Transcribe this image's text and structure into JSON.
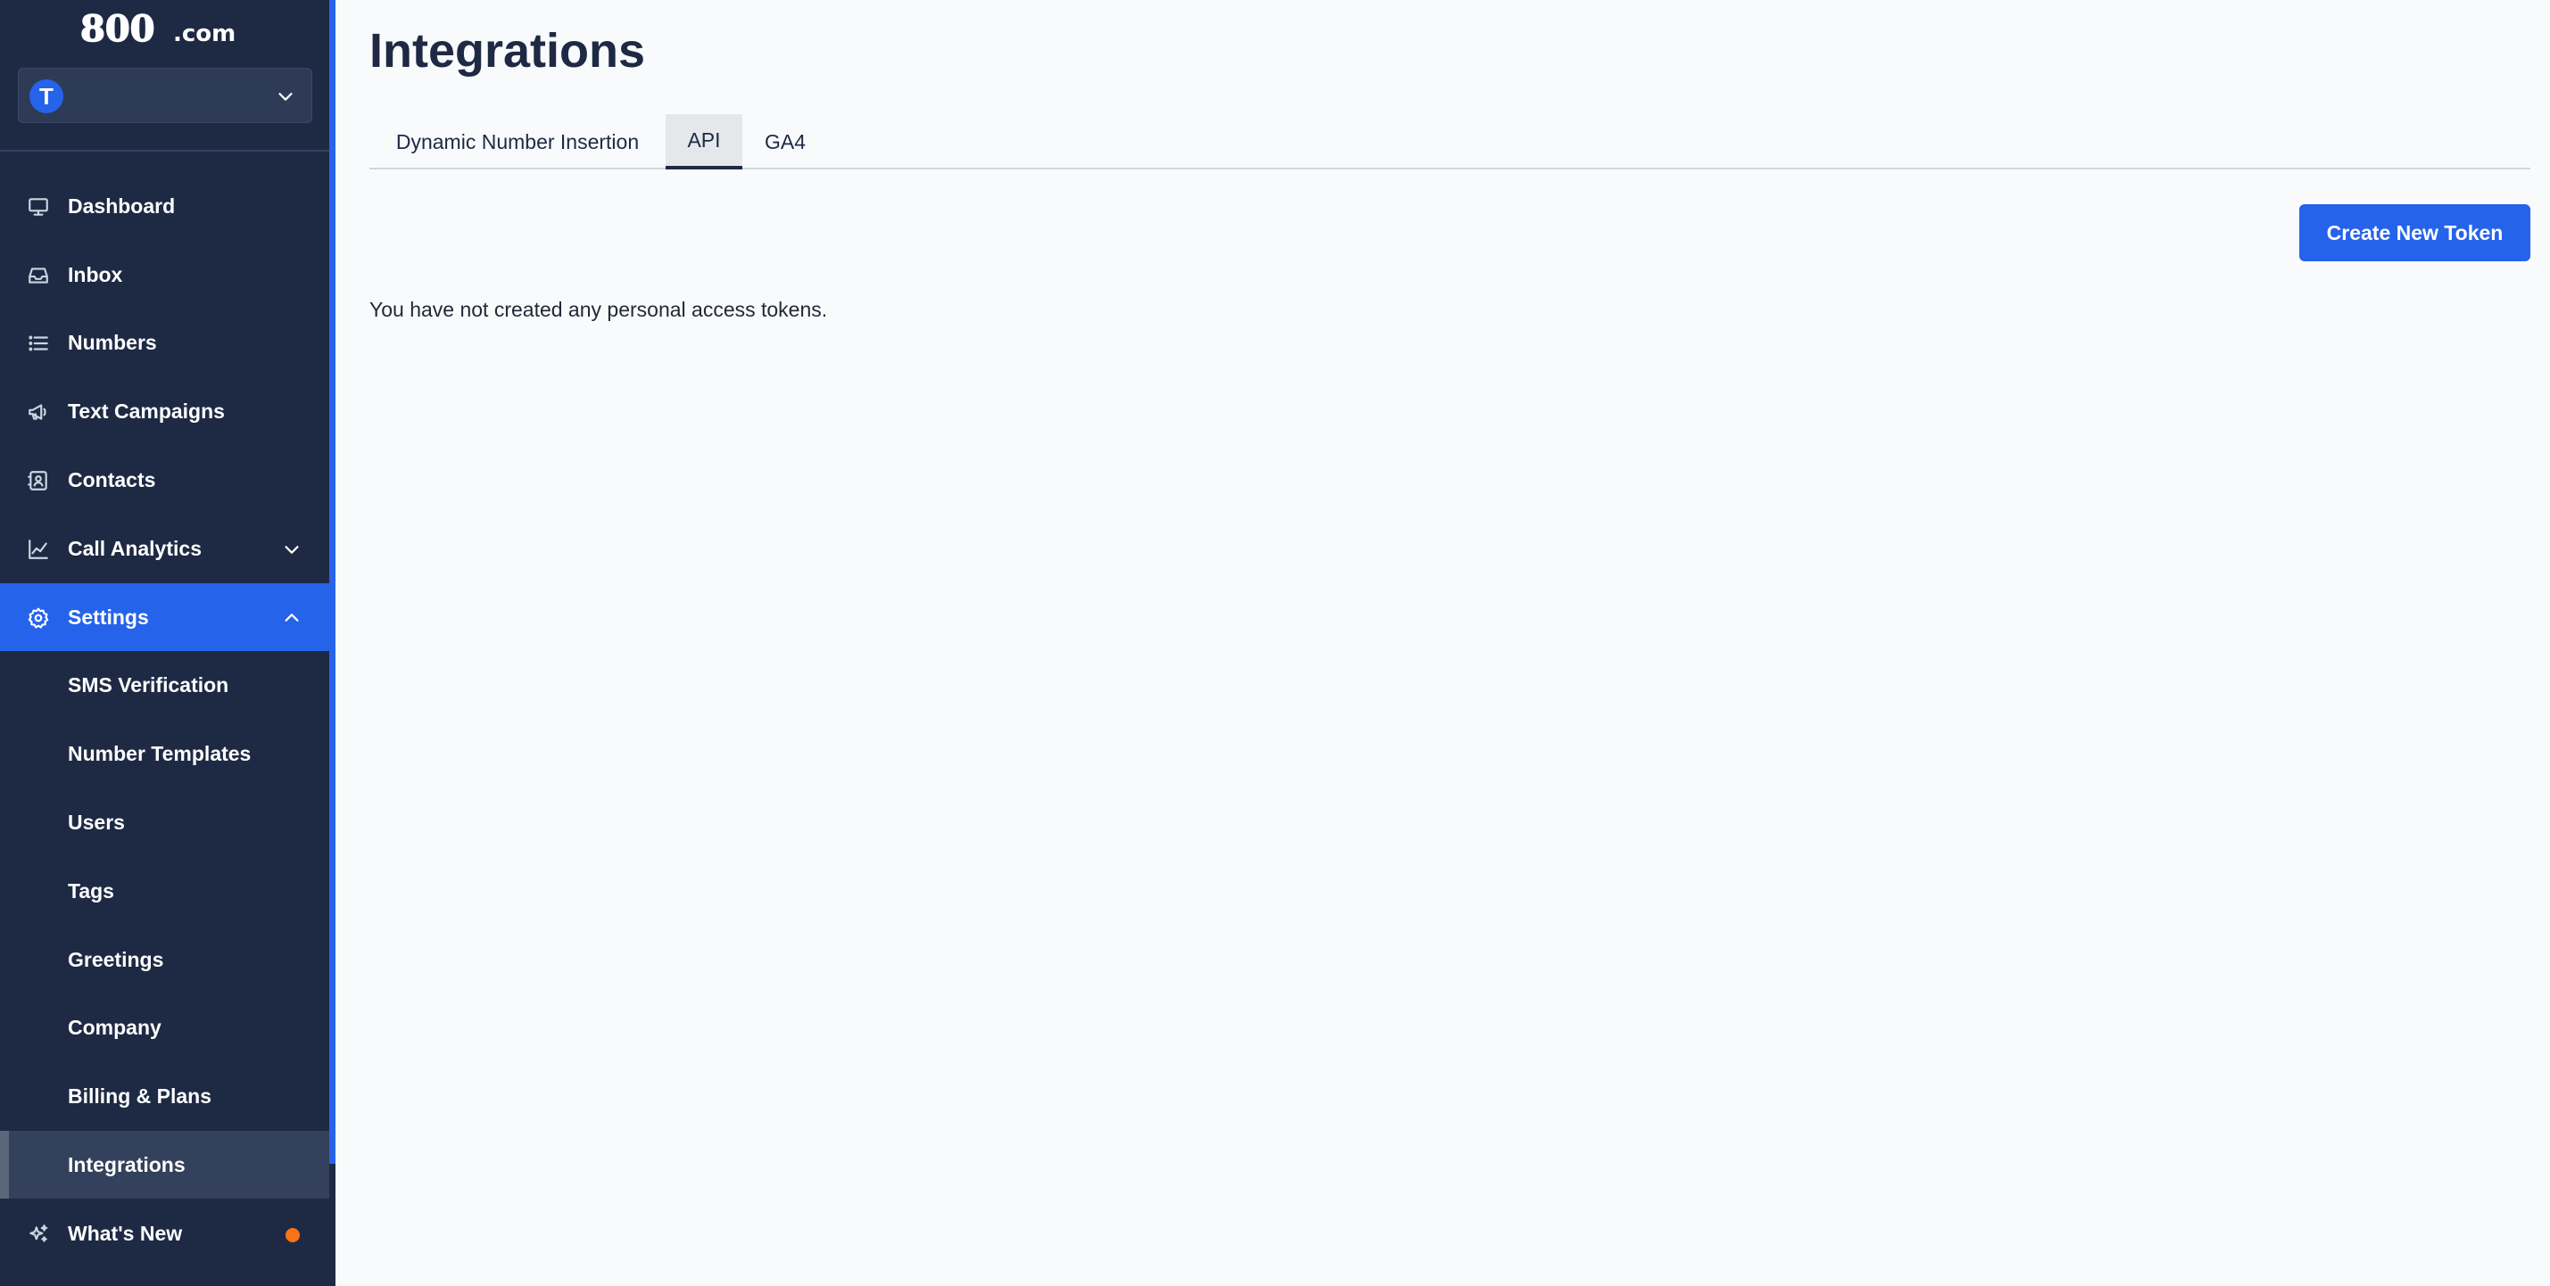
{
  "brand": {
    "logo_text": "800.com"
  },
  "account": {
    "avatar_letter": "T"
  },
  "sidebar": {
    "items": [
      {
        "label": "Dashboard",
        "icon": "monitor-icon"
      },
      {
        "label": "Inbox",
        "icon": "inbox-icon"
      },
      {
        "label": "Numbers",
        "icon": "list-icon"
      },
      {
        "label": "Text Campaigns",
        "icon": "megaphone-icon"
      },
      {
        "label": "Contacts",
        "icon": "contact-card-icon"
      },
      {
        "label": "Call Analytics",
        "icon": "chart-line-icon",
        "expandable": true
      },
      {
        "label": "Settings",
        "icon": "gear-icon",
        "expanded": true,
        "active": true
      }
    ],
    "settings_sub_items": [
      {
        "label": "SMS Verification"
      },
      {
        "label": "Number Templates"
      },
      {
        "label": "Users"
      },
      {
        "label": "Tags"
      },
      {
        "label": "Greetings"
      },
      {
        "label": "Company"
      },
      {
        "label": "Billing & Plans"
      },
      {
        "label": "Integrations",
        "current": true
      }
    ],
    "whats_new": {
      "label": "What's New",
      "icon": "sparkles-icon",
      "has_notification": true
    }
  },
  "main": {
    "title": "Integrations",
    "tabs": [
      {
        "label": "Dynamic Number Insertion"
      },
      {
        "label": "API",
        "active": true
      },
      {
        "label": "GA4"
      }
    ],
    "create_button_label": "Create New Token",
    "empty_message": "You have not created any personal access tokens."
  },
  "colors": {
    "sidebar_bg": "#1e2a44",
    "accent": "#2563eb",
    "notification": "#f97316",
    "page_bg": "#f8fafc"
  }
}
